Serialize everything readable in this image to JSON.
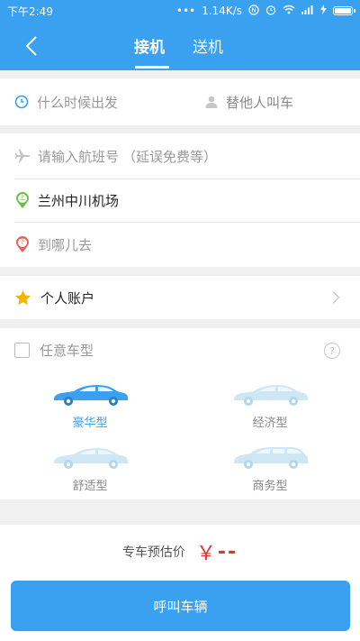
{
  "status_bar": {
    "time": "下午2:49",
    "dots": "•••",
    "speed": "1.14K/s"
  },
  "nav": {
    "tab_pickup": "接机",
    "tab_dropoff": "送机"
  },
  "time_row": {
    "departure_placeholder": "什么时候出发",
    "for_others": "替他人叫车"
  },
  "route": {
    "flight_placeholder": "请输入航班号",
    "flight_hint": "（延误免费等）",
    "pickup_badge": "上",
    "pickup_location": "兰州中川机场",
    "dropoff_badge": "下",
    "dropoff_placeholder": "到哪儿去"
  },
  "account": {
    "label": "个人账户"
  },
  "car_types": {
    "any_label": "任意车型",
    "help": "?",
    "items": [
      {
        "label": "豪华型",
        "selected": true
      },
      {
        "label": "经济型",
        "selected": false
      },
      {
        "label": "舒适型",
        "selected": false
      },
      {
        "label": "商务型",
        "selected": false
      }
    ]
  },
  "estimate": {
    "label": "专车预估价",
    "currency": "￥",
    "price": "--"
  },
  "call_button": "呼叫车辆",
  "colors": {
    "primary": "#3aa0f0",
    "price_red": "#e8302f",
    "star": "#f5b400",
    "pickup_green": "#6cc04a",
    "dropoff_red": "#e9605c",
    "car_light": "#cfe6f5"
  }
}
